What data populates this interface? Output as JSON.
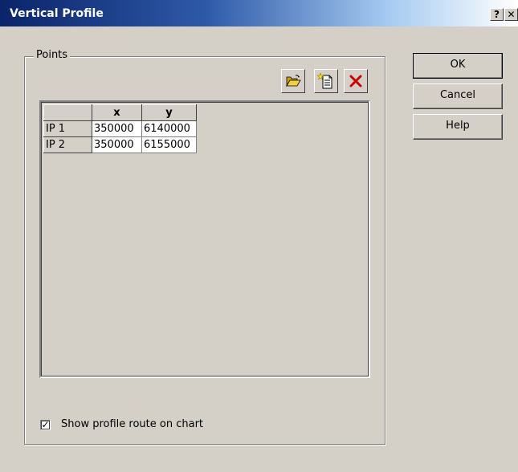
{
  "window": {
    "title": "Vertical Profile",
    "help_glyph": "?",
    "close_glyph": "✕"
  },
  "points_group": {
    "label": "Points",
    "toolbar": {
      "open_icon": "folder-open-icon",
      "new_icon": "new-document-icon",
      "delete_icon": "delete-x-icon"
    },
    "table": {
      "columns": [
        "",
        "x",
        "y"
      ],
      "rows": [
        {
          "label": "IP 1",
          "x": "350000",
          "y": "6140000"
        },
        {
          "label": "IP 2",
          "x": "350000",
          "y": "6155000"
        }
      ]
    },
    "show_route": {
      "label": "Show profile route on chart",
      "checked": true,
      "check_glyph": "✓"
    }
  },
  "buttons": {
    "ok": "OK",
    "cancel": "Cancel",
    "help": "Help"
  },
  "colors": {
    "dialog_bg": "#d4d0c8",
    "title_start": "#0a246a",
    "title_end": "#a6caf0",
    "delete_red": "#cc0000"
  }
}
